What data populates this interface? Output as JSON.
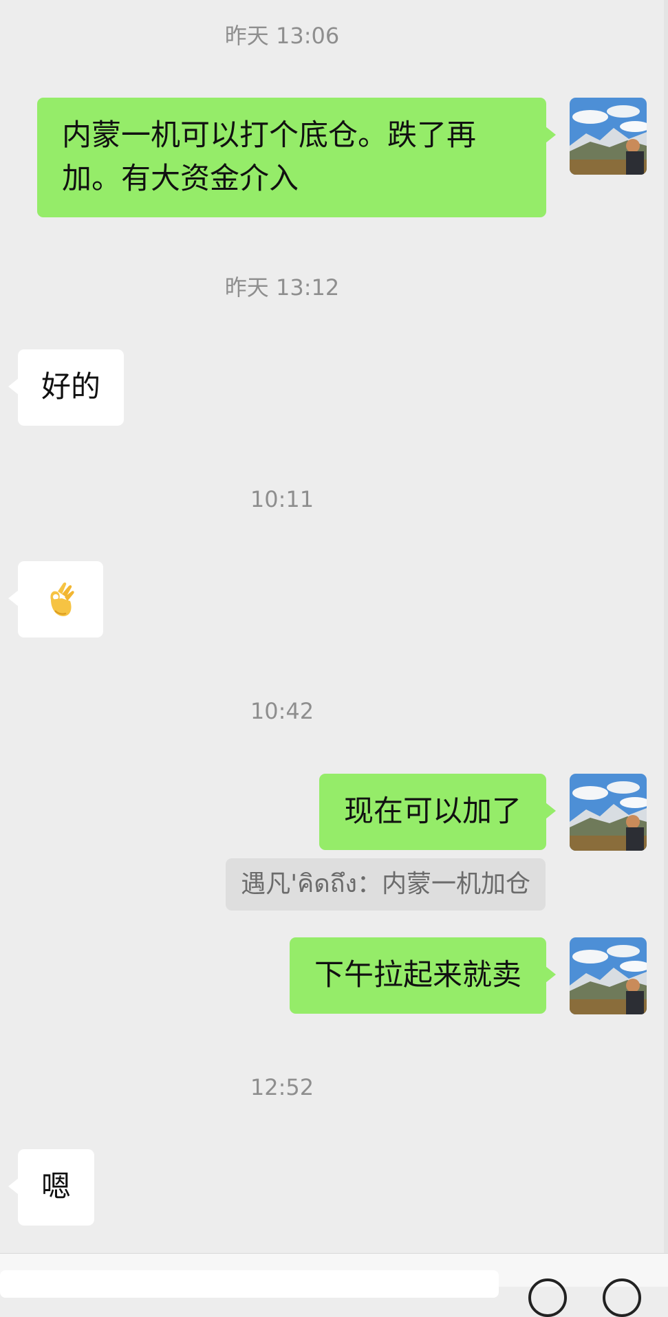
{
  "messages": {
    "t1": "昨天 13:06",
    "m1_line1": "内蒙一机可以打个底仓。跌了再",
    "m1_line2": "加。有大资金介入",
    "t2": "昨天 13:12",
    "m2": "好的",
    "t3": "10:11",
    "m3_emoji": "👌",
    "t4": "10:42",
    "m4": "现在可以加了",
    "m4_quote": "遇凡'คิดถึง：内蒙一机加仓",
    "m5": "下午拉起来就卖",
    "t5": "12:52",
    "m6": "嗯"
  },
  "colors": {
    "outgoing_bubble": "#95ec69",
    "incoming_bubble": "#ffffff",
    "background": "#ededed",
    "timestamp_text": "#8e8e8e"
  },
  "icons": {
    "avatar": "mountain-landscape-avatar",
    "emoji": "ok-hand-emoji",
    "bottom_left": "voice-icon",
    "bottom_right": "add-icon"
  }
}
